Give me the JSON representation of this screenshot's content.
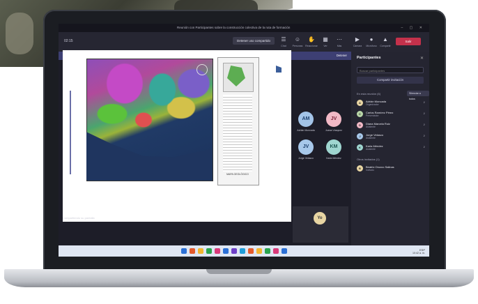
{
  "meeting": {
    "window_title": "Reunión con Participantes sobre la construcción colectiva de la ruta de formación",
    "timer": "02:15",
    "presenter_button": "Detener uso compartido",
    "toolbar": [
      "Chat",
      "Personas",
      "Reaccionar",
      "Ver",
      "Notas",
      "Más",
      "Cámara",
      "Micrófono",
      "Compartir"
    ],
    "leave_label": "Salir",
    "banner_text": "Está presentando. Los participantes solo verán su pantalla. Activar el modo presentador para grabar la reunión.",
    "banner_action": "Detener",
    "presenter_tag": "Compartiendo su pantalla",
    "legend_caption": "MAPA GEOLÓGICO"
  },
  "tiles": [
    {
      "initials": "AM",
      "label": "Adrián Moncada",
      "bg": "#a3c4e8",
      "fg": "#1c3f6b"
    },
    {
      "initials": "JV",
      "label": "Juana Vásquez",
      "bg": "#f2b9c6",
      "fg": "#7a1f35"
    },
    {
      "initials": "JV",
      "label": "Jorge Velasco",
      "bg": "#a7c8ea",
      "fg": "#1c3f6b"
    },
    {
      "initials": "KM",
      "label": "Karla Méndez",
      "bg": "#9fd6d0",
      "fg": "#1c5550"
    }
  ],
  "self_initials": "Yo",
  "participants_panel": {
    "title": "Participantes",
    "search_placeholder": "Buscar participantes",
    "share_invite": "Compartir invitación",
    "in_meeting_label": "En esta reunión (6)",
    "mute_all": "Silenciar a todos",
    "others_label": "Otros invitados (1)",
    "people": [
      {
        "name": "Adrián Moncada",
        "role": "Organizador",
        "color": "#e8d5a3"
      },
      {
        "name": "Carlos Ramírez Pérez",
        "role": "Presentador",
        "color": "#b9d7a8"
      },
      {
        "name": "Diana Marcela Ruiz",
        "role": "Asistente",
        "color": "#f2b9c6"
      },
      {
        "name": "Jorge Velasco",
        "role": "Asistente",
        "color": "#a7c8ea"
      },
      {
        "name": "Karla Méndez",
        "role": "Asistente",
        "color": "#9fd6d0"
      }
    ],
    "invited": [
      {
        "name": "Beatriz Orozco Salinas",
        "role": "Invitado",
        "color": "#e8d5a3"
      }
    ]
  },
  "taskbar": {
    "icon_colors": [
      "#2b6fd6",
      "#e45a2c",
      "#f2b630",
      "#2aa44f",
      "#d93a7a",
      "#2b6fd6",
      "#6d3fc7",
      "#1f9dd9",
      "#e45a2c",
      "#f2b630",
      "#2aa44f",
      "#d93a7a",
      "#2b6fd6"
    ],
    "tray": "ESP",
    "clock": "10:42 a. m."
  }
}
